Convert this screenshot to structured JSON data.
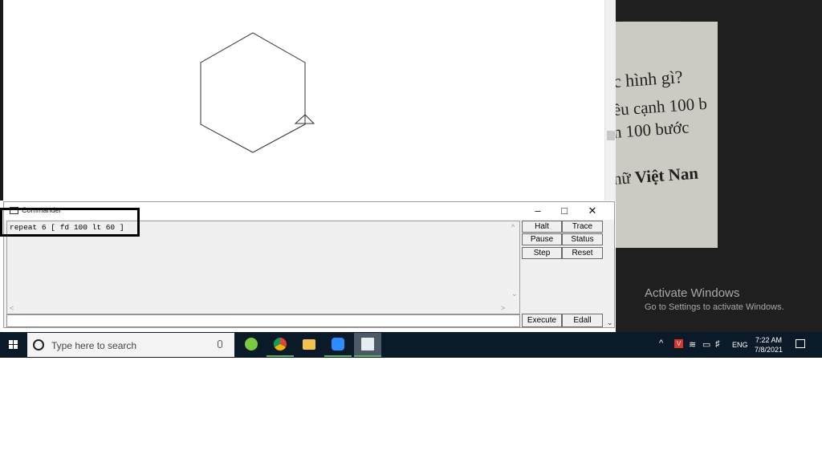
{
  "commander": {
    "title": "Commander",
    "history_text": "repeat 6 [ fd 100 lt 60 ]",
    "buttons": {
      "halt": "Halt",
      "trace": "Trace",
      "pause": "Pause",
      "status": "Status",
      "step": "Step",
      "reset": "Reset",
      "execute": "Execute",
      "edall": "Edall"
    },
    "input_value": ""
  },
  "photo": {
    "line1": "c hình gì?",
    "line2": "ều cạnh 100 b",
    "line3": "h 100 bước",
    "line4_prefix": "hữ ",
    "line4_bold": "Việt Nan"
  },
  "activation": {
    "title": "Activate Windows",
    "subtitle": "Go to Settings to activate Windows."
  },
  "taskbar": {
    "search_placeholder": "Type here to search",
    "apps": [
      {
        "name": "sync-app-icon",
        "color": "#7ac943"
      },
      {
        "name": "chrome-icon",
        "color": "#e8a21c"
      },
      {
        "name": "file-explorer-icon",
        "color": "#f2c14e"
      },
      {
        "name": "zoom-icon",
        "color": "#2d8cff"
      },
      {
        "name": "logo-app-icon",
        "color": "#c4d2dc"
      }
    ],
    "language": "ENG",
    "time": "7:22 AM",
    "date": "7/8/2021"
  }
}
